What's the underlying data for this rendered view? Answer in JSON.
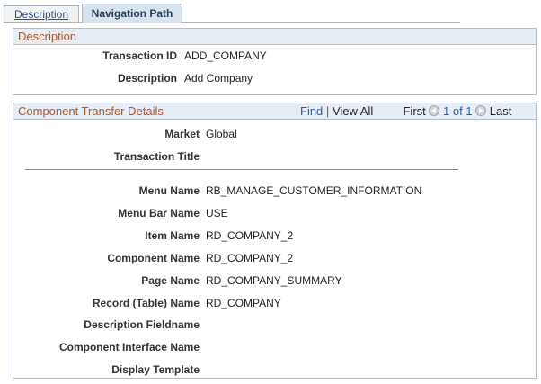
{
  "tabs": [
    {
      "label": "Description",
      "active": false
    },
    {
      "label": "Navigation Path",
      "active": true
    }
  ],
  "description_group": {
    "title": "Description",
    "fields": [
      {
        "label": "Transaction ID",
        "value": "ADD_COMPANY"
      },
      {
        "label": "Description",
        "value": "Add Company"
      }
    ]
  },
  "component_group": {
    "title": "Component Transfer Details",
    "nav": {
      "find": "Find",
      "separator": "|",
      "view_all": "View All",
      "first": "First",
      "range": "1 of 1",
      "last": "Last"
    },
    "top_fields": [
      {
        "label": "Market",
        "value": "Global"
      },
      {
        "label": "Transaction Title",
        "value": ""
      }
    ],
    "fields": [
      {
        "label": "Menu Name",
        "value": "RB_MANAGE_CUSTOMER_INFORMATION"
      },
      {
        "label": "Menu Bar Name",
        "value": "USE"
      },
      {
        "label": "Item Name",
        "value": "RD_COMPANY_2"
      },
      {
        "label": "Component Name",
        "value": "RD_COMPANY_2"
      },
      {
        "label": "Page Name",
        "value": "RD_COMPANY_SUMMARY"
      },
      {
        "label": "Record (Table) Name",
        "value": "RD_COMPANY"
      },
      {
        "label": "Description Fieldname",
        "value": ""
      },
      {
        "label": "Component Interface Name",
        "value": ""
      },
      {
        "label": "Display Template",
        "value": ""
      }
    ]
  },
  "colors": {
    "header_text": "#b1542a",
    "header_bg": "#e6edf4",
    "link": "#2a5aa3",
    "active_tab_bg": "#d9e3ed"
  }
}
